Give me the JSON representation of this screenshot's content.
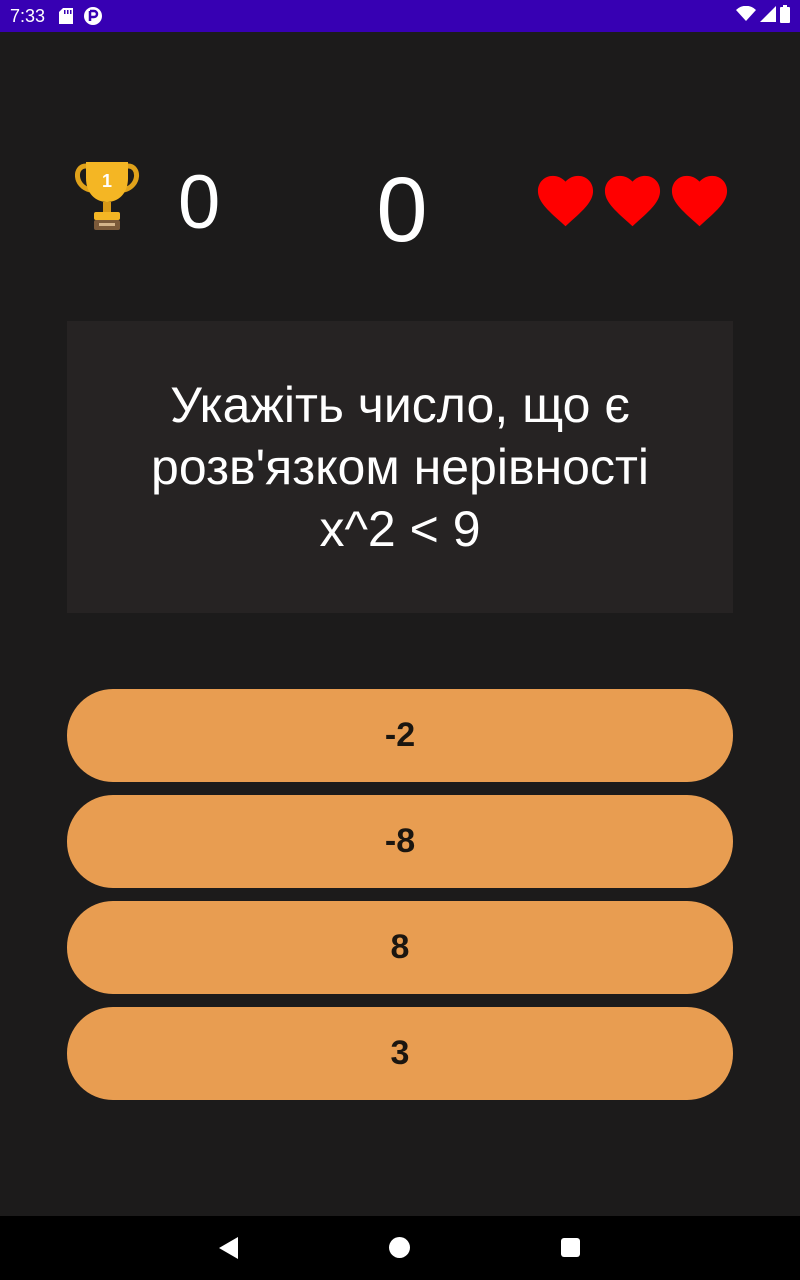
{
  "status_bar": {
    "time": "7:33",
    "icons_left": [
      "sd-card-icon",
      "app-notification-icon"
    ],
    "icons_right": [
      "wifi-icon",
      "signal-icon",
      "battery-icon"
    ],
    "color": "#3700b3"
  },
  "game": {
    "best_score": "0",
    "current_score": "0",
    "lives": 3,
    "trophy_rank": "1",
    "heart_color": "#ff0000"
  },
  "question": {
    "text": "Укажіть число, що є\nрозв'язком нерівності\nx^2 < 9"
  },
  "answers": [
    {
      "label": "-2"
    },
    {
      "label": "-8"
    },
    {
      "label": "8"
    },
    {
      "label": "3"
    }
  ],
  "colors": {
    "background": "#1c1b1b",
    "question_box": "#262323",
    "answer_button": "#e89d51"
  }
}
